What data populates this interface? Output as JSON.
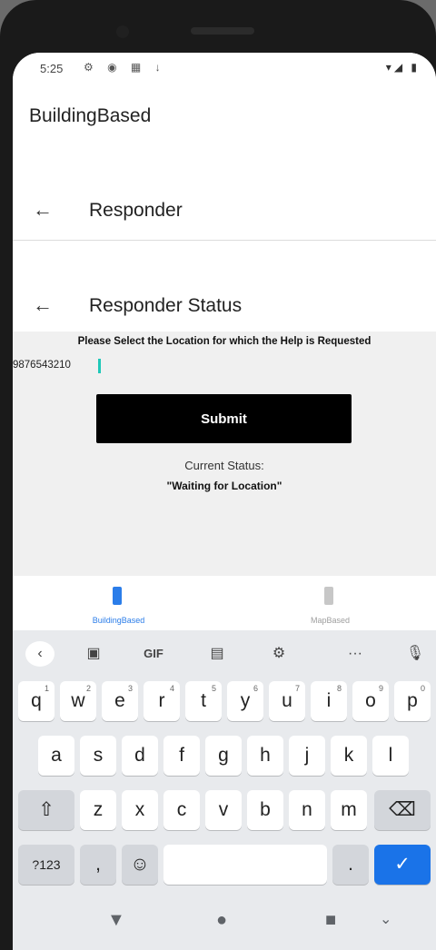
{
  "status_bar": {
    "time": "5:25",
    "left_icons": "⚙ ◉ ▦ ↓",
    "right_icons": "▾◢ ▮"
  },
  "app": {
    "title": "BuildingBased"
  },
  "nav_primary": {
    "title": "Responder"
  },
  "nav_secondary": {
    "title": "Responder Status"
  },
  "form": {
    "prompt": "Please Select the Location for which the Help is Requested",
    "phone_value": "9876543210",
    "submit_label": "Submit",
    "status_label": "Current Status:",
    "status_value": "\"Waiting for Location\""
  },
  "bottom_nav": {
    "items": [
      {
        "label": "BuildingBased",
        "active": true,
        "color": "#2b7de9"
      },
      {
        "label": "MapBased",
        "active": false,
        "color": "#9e9e9e"
      }
    ]
  },
  "keyboard": {
    "toolbar": [
      "back-icon",
      "sticker-icon",
      "GIF",
      "clipboard-icon",
      "gear-icon",
      "more-icon",
      "mic-icon"
    ],
    "gif_label": "GIF",
    "row1": [
      "q",
      "w",
      "e",
      "r",
      "t",
      "y",
      "u",
      "i",
      "o",
      "p"
    ],
    "row1_hints": [
      "1",
      "2",
      "3",
      "4",
      "5",
      "6",
      "7",
      "8",
      "9",
      "0"
    ],
    "row2": [
      "a",
      "s",
      "d",
      "f",
      "g",
      "h",
      "j",
      "k",
      "l"
    ],
    "row3": [
      "z",
      "x",
      "c",
      "v",
      "b",
      "n",
      "m"
    ],
    "symbols_label": "?123",
    "comma_label": ",",
    "period_label": ".",
    "enter_icon": "check-icon"
  },
  "accent_color": "#1a73e8"
}
